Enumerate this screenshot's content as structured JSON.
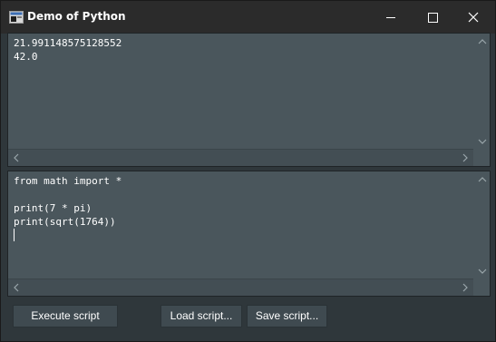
{
  "window": {
    "title": "Demo of Python"
  },
  "output": {
    "lines": [
      "21.991148575128552",
      "42.0"
    ]
  },
  "editor": {
    "lines": [
      "from math import *",
      "",
      "print(7 * pi)",
      "print(sqrt(1764))"
    ]
  },
  "buttons": {
    "execute": "Execute script",
    "load": "Load script...",
    "save": "Save script..."
  },
  "colors": {
    "window_bg": "#2f373b",
    "titlebar_bg": "#2b2b2b",
    "pane_bg": "#4a565c",
    "text": "#ffffff"
  },
  "icons": {
    "app": "python-app-icon",
    "minimize": "minimize-icon",
    "maximize": "maximize-icon",
    "close": "close-icon"
  }
}
